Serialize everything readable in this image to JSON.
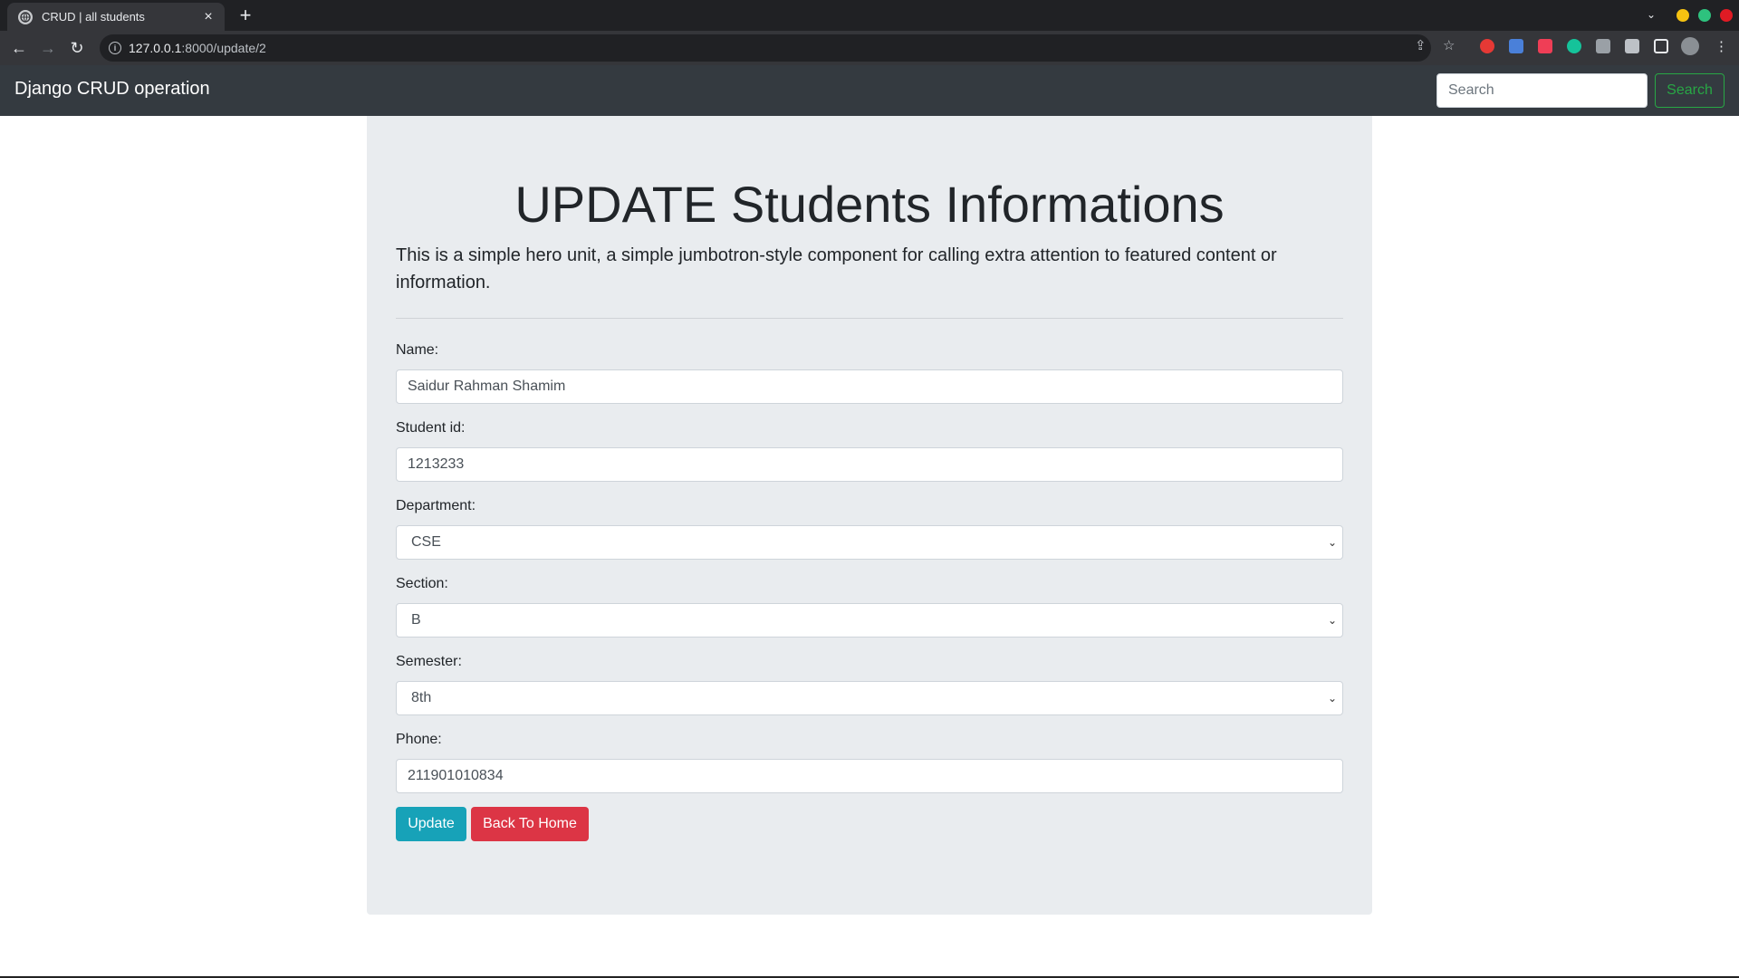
{
  "browser": {
    "tab_title": "CRUD | all students",
    "tab_close": "×",
    "new_tab": "+",
    "url_host": "127.0.0.1",
    "url_path": ":8000/update/2",
    "tab_search": "⌄"
  },
  "navbar": {
    "brand": "Django CRUD operation",
    "search_placeholder": "Search",
    "search_button": "Search"
  },
  "jumbotron": {
    "title": "UPDATE Students Informations",
    "lead": "This is a simple hero unit, a simple jumbotron-style component for calling extra attention to featured content or information."
  },
  "form": {
    "name_label": "Name:",
    "name_value": "Saidur Rahman Shamim",
    "student_id_label": "Student id:",
    "student_id_value": "1213233",
    "department_label": "Department:",
    "department_value": "CSE",
    "section_label": "Section:",
    "section_value": "B",
    "semester_label": "Semester:",
    "semester_value": "8th",
    "phone_label": "Phone:",
    "phone_value": "211901010834",
    "update_button": "Update",
    "home_button": "Back To Home"
  },
  "colors": {
    "navbar": "#343a40",
    "jumbotron": "#e9ecef",
    "update": "#17a2b8",
    "home": "#dc3545",
    "search_outline": "#28a745"
  }
}
